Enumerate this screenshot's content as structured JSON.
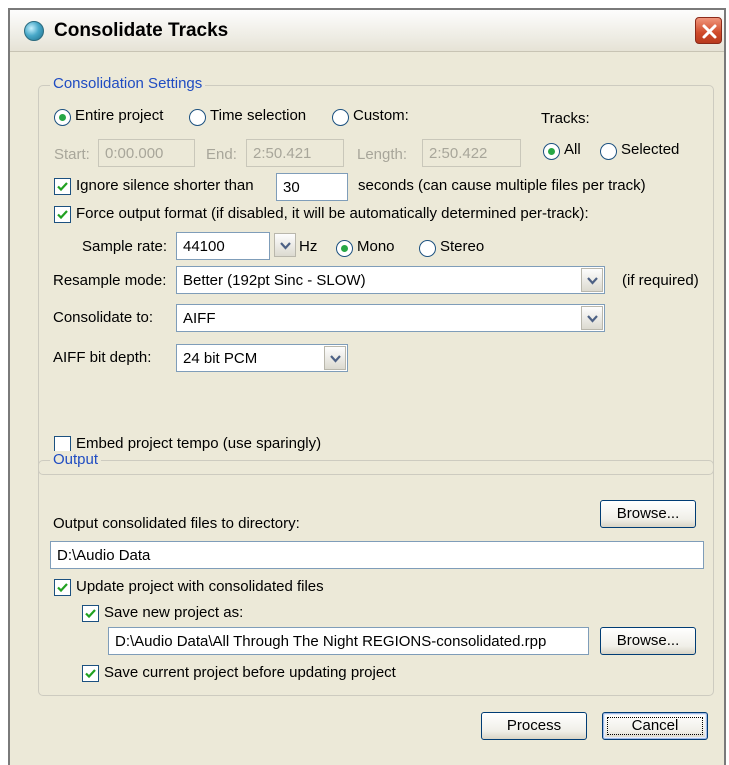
{
  "window": {
    "title": "Consolidate Tracks"
  },
  "settings": {
    "legend": "Consolidation Settings",
    "range_options": [
      "Entire project",
      "Time selection",
      "Custom:"
    ],
    "tracks_label": "Tracks:",
    "tracks_options": [
      "All",
      "Selected"
    ],
    "start_label": "Start:",
    "start_value": "0:00.000",
    "end_label": "End:",
    "end_value": "2:50.421",
    "length_label": "Length:",
    "length_value": "2:50.422",
    "ignore_silence_label": "Ignore silence shorter than",
    "ignore_silence_value": "30",
    "ignore_silence_suffix": "seconds (can cause multiple files per track)",
    "force_format_label": "Force output format (if disabled, it will be automatically determined per-track):",
    "sample_rate_label": "Sample rate:",
    "sample_rate_value": "44100",
    "hz_label": "Hz",
    "channel_options": [
      "Mono",
      "Stereo"
    ],
    "resample_label": "Resample mode:",
    "resample_value": "Better (192pt Sinc - SLOW)",
    "resample_suffix": "(if required)",
    "consolidate_to_label": "Consolidate to:",
    "consolidate_to_value": "AIFF",
    "bit_depth_label": "AIFF bit depth:",
    "bit_depth_value": "24 bit PCM",
    "embed_tempo_label": "Embed project tempo (use sparingly)"
  },
  "output": {
    "legend": "Output",
    "directory_label": "Output consolidated files to directory:",
    "browse_label": "Browse...",
    "directory_value": "D:\\Audio Data",
    "update_project_label": "Update project with consolidated files",
    "save_new_label": "Save new project as:",
    "save_new_value": "D:\\Audio Data\\All Through The Night REGIONS-consolidated.rpp",
    "browse2_label": "Browse...",
    "save_current_label": "Save current project before updating project"
  },
  "buttons": {
    "process": "Process",
    "cancel": "Cancel"
  },
  "colors": {
    "accent": "#1f4cc2",
    "radio_dot": "#27a745",
    "close_red": "#cf4a2a"
  }
}
